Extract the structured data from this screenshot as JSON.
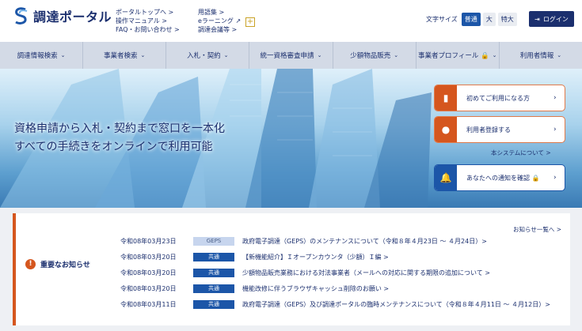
{
  "header": {
    "logo_text": "調達ポータル",
    "links_col1": [
      "ポータルトップへ >",
      "操作マニュアル >",
      "FAQ・お問い合わせ >"
    ],
    "links_col2": [
      "用語集 >",
      "eラーニング ↗",
      "調達会議等 >"
    ],
    "font_size_label": "文字サイズ",
    "font_sizes": [
      "普通",
      "大",
      "特大"
    ],
    "login_label": "ログイン"
  },
  "nav": [
    "調達情報検索",
    "事業者検索",
    "入札・契約",
    "統一資格審査申請",
    "少額物品販売",
    "事業者プロフィール 🔒",
    "利用者情報"
  ],
  "hero": {
    "line1": "資格申請から入札・契約まで窓口を一本化",
    "line2": "すべての手続きをオンラインで利用可能",
    "card1": "初めてご利用になる方",
    "card2": "利用者登録する",
    "system_link": "本システムについて >",
    "card3": "あなたへの通知を確認 🔒"
  },
  "notices": {
    "heading": "重要なお知らせ",
    "list_link": "お知らせ一覧へ >",
    "items": [
      {
        "date": "令和08年03月23日",
        "badge": "GEPS",
        "title": "政府電子調達（GEPS）のメンテナンスについて（令和８年４月23日 ～ ４月24日）>"
      },
      {
        "date": "令和08年03月20日",
        "badge": "共通",
        "title": "【新機能紹介】Ｉオープンカウンタ（少額）Ｉ編 >"
      },
      {
        "date": "令和08年03月20日",
        "badge": "共通",
        "title": "少額物品販売業務における対法事業者（メールへの対応に関する期限の追加について >"
      },
      {
        "date": "令和08年03月20日",
        "badge": "共通",
        "title": "機能改修に伴うブラウザキャッシュ削除のお願い >"
      },
      {
        "date": "令和08年03月11日",
        "badge": "共通",
        "title": "政府電子調達（GEPS）及び調達ポータルの臨時メンテナンスについて（令和８年４月11日 ～ ４月12日）>"
      }
    ]
  },
  "colors": {
    "primary": "#1b2f6e",
    "accent": "#d5561e",
    "blue": "#1c56a8"
  }
}
